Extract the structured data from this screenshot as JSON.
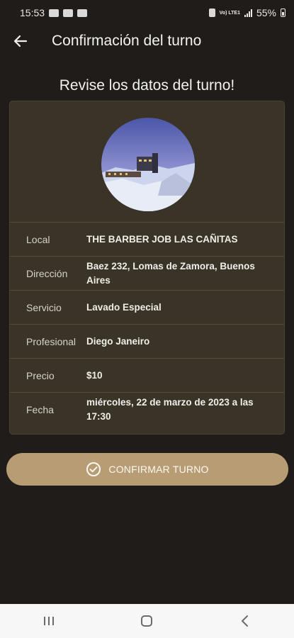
{
  "status_bar": {
    "time": "15:53",
    "battery_percent": "55%",
    "network_label": "Vo) LTE1"
  },
  "app_bar": {
    "title": "Confirmación del turno",
    "back_icon": "arrow-left-icon"
  },
  "subtitle": "Revise los datos del turno!",
  "details": [
    {
      "label": "Local",
      "value": "THE BARBER JOB LAS CAÑITAS"
    },
    {
      "label": "Dirección",
      "value": "Baez 232, Lomas de Zamora,  Buenos Aires"
    },
    {
      "label": "Servicio",
      "value": "Lavado Especial"
    },
    {
      "label": "Profesional",
      "value": "Diego Janeiro"
    },
    {
      "label": "Precio",
      "value": "$10"
    },
    {
      "label": "Fecha",
      "value": "miércoles, 22 de marzo de 2023 a las 17:30"
    }
  ],
  "confirm_button": {
    "label": "CONFIRMAR TURNO",
    "icon": "check-circle-icon"
  },
  "colors": {
    "background": "#1f1c19",
    "card": "#3a3327",
    "accent": "#b89c73"
  },
  "nav_bar": {
    "icons": [
      "recent-apps-icon",
      "home-icon",
      "back-nav-icon"
    ]
  }
}
